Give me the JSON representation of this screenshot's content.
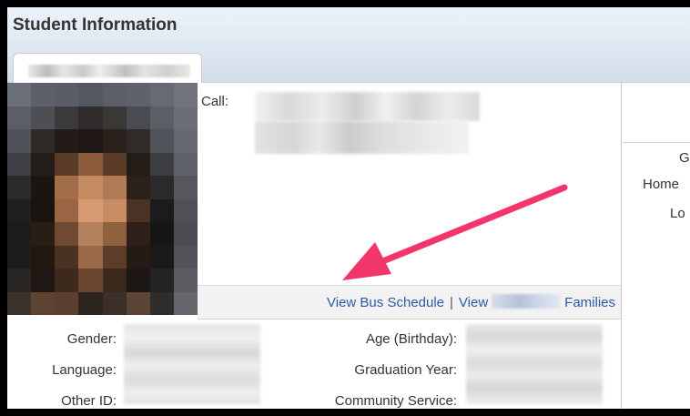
{
  "header": {
    "title": "Student Information"
  },
  "tabs": [
    {
      "label_redacted": true
    }
  ],
  "contact": {
    "call_label": "Call:"
  },
  "links": {
    "bus_schedule": "View Bus Schedule",
    "separator": "|",
    "view_prefix": "View",
    "families_suffix": "Families"
  },
  "fields": {
    "gender": "Gender:",
    "language": "Language:",
    "other_id": "Other ID:",
    "age_birthday": "Age (Birthday):",
    "graduation_year": "Graduation Year:",
    "community_service": "Community Service:"
  },
  "right_panel": {
    "labels": [
      "G",
      "Home",
      "Lo"
    ]
  },
  "colors": {
    "link": "#2b5ba7",
    "arrow": "#f2356b",
    "header_bg": "#dde6f1"
  },
  "annotation": {
    "arrow_color": "#f2356b",
    "target": "View Bus Schedule"
  }
}
